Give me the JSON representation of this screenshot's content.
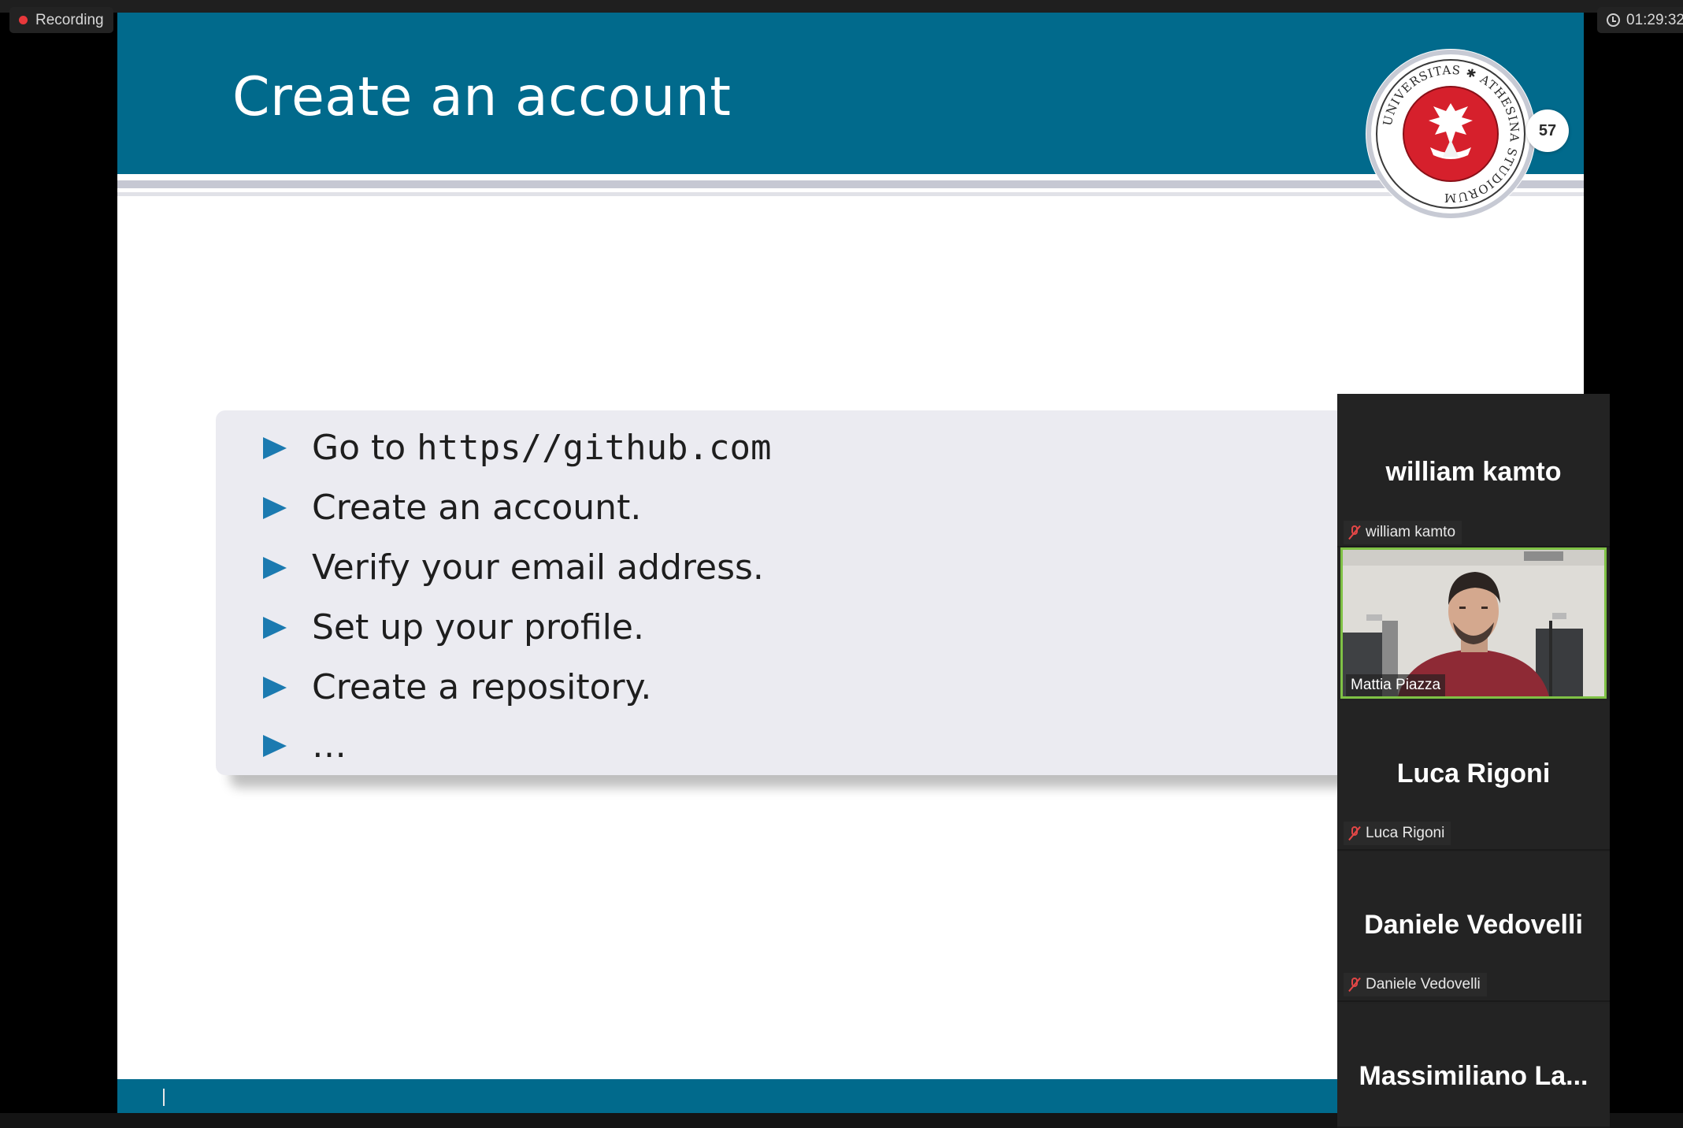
{
  "recording": {
    "label": "Recording"
  },
  "timer": {
    "elapsed": "01:29:32"
  },
  "slide": {
    "title": "Create an account",
    "page_number": "57",
    "logo": {
      "alt": "University of Trento seal",
      "ring_text": "UNIVERSITAS ✱ ATHESINA STUDIORUM"
    },
    "bullets": [
      {
        "prefix": "Go to ",
        "code": "https//github.com"
      },
      {
        "prefix": "Create an account.",
        "code": ""
      },
      {
        "prefix": "Verify your email address.",
        "code": ""
      },
      {
        "prefix": "Set up your profile.",
        "code": ""
      },
      {
        "prefix": "Create a repository.",
        "code": ""
      },
      {
        "prefix": "…",
        "code": ""
      }
    ]
  },
  "participants": [
    {
      "display_name": "william kamto",
      "tag": "william kamto",
      "muted": true
    },
    {
      "video_name": "Mattia Piazza",
      "video_on": true
    },
    {
      "display_name": "Luca Rigoni",
      "tag": "Luca Rigoni",
      "muted": true
    },
    {
      "display_name": "Daniele Vedovelli",
      "tag": "Daniele Vedovelli",
      "muted": true
    },
    {
      "display_name": "Massimiliano  La..."
    }
  ],
  "colors": {
    "slide_header": "#016a8c",
    "bullet_triangle": "#1b7ab0",
    "recording_dot": "#e8383b",
    "active_speaker_border": "#7fc145",
    "muted_icon": "#e24646"
  },
  "icons": [
    "recording-dot-icon",
    "clock-icon",
    "mic-off-icon",
    "bullet-triangle-icon"
  ]
}
